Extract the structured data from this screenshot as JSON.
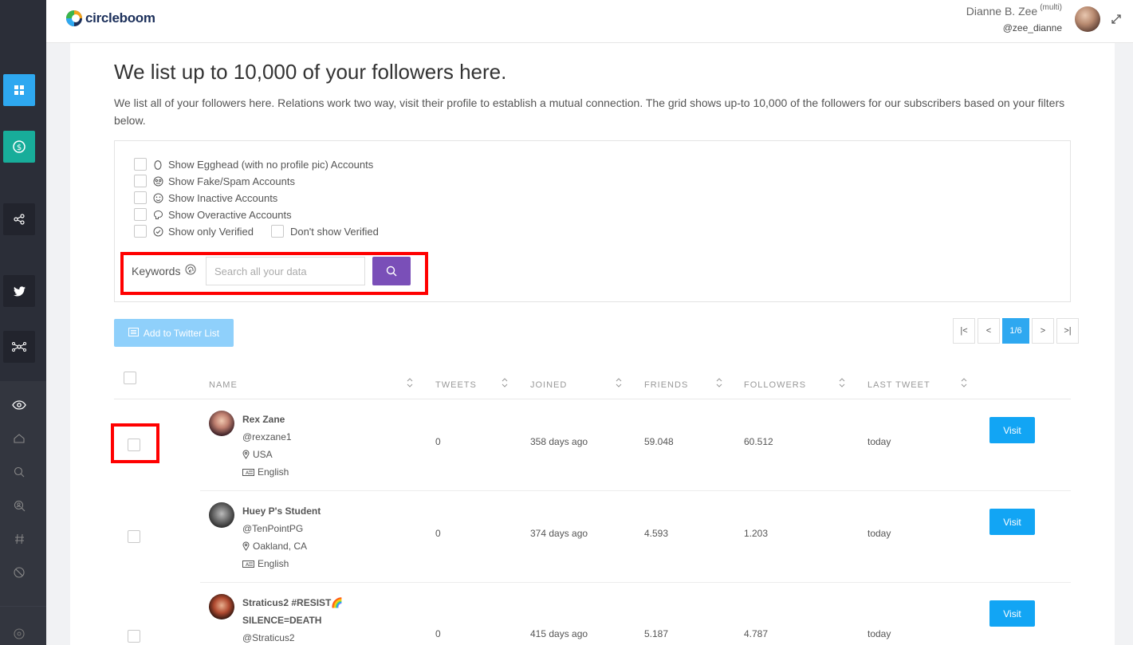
{
  "header": {
    "logo_text": "circleboom",
    "user_name": "Dianne B. Zee",
    "user_tag": "(multi)",
    "user_handle": "@zee_dianne"
  },
  "page": {
    "title": "We list up to 10,000 of your followers here.",
    "description": "We list all of your followers here. Relations work two way, visit their profile to establish a mutual connection. The grid shows up-to 10,000 of the followers for our subscribers based on your filters below."
  },
  "filters": {
    "egghead": "Show Egghead (with no profile pic) Accounts",
    "fake_spam": "Show Fake/Spam Accounts",
    "inactive": "Show Inactive Accounts",
    "overactive": "Show Overactive Accounts",
    "only_verified": "Show only Verified",
    "dont_show_verified": "Don't show Verified"
  },
  "keywords": {
    "label": "Keywords",
    "placeholder": "Search all your data"
  },
  "toolbar": {
    "add_list_label": "Add to Twitter List"
  },
  "pager": {
    "first": "|<",
    "prev": "<",
    "current": "1/6",
    "next": ">",
    "last": ">|"
  },
  "table": {
    "columns": {
      "name": "NAME",
      "tweets": "TWEETS",
      "joined": "JOINED",
      "friends": "FRIENDS",
      "followers": "FOLLOWERS",
      "last_tweet": "LAST TWEET"
    },
    "visit_label": "Visit",
    "rows": [
      {
        "name": "Rex Zane",
        "handle": "@rexzane1",
        "location": "USA",
        "language": "English",
        "tweets": "0",
        "joined": "358 days ago",
        "friends": "59.048",
        "followers": "60.512",
        "last_tweet": "today"
      },
      {
        "name": "Huey P's Student",
        "handle": "@TenPointPG",
        "location": "Oakland, CA",
        "language": "English",
        "tweets": "0",
        "joined": "374 days ago",
        "friends": "4.593",
        "followers": "1.203",
        "last_tweet": "today"
      },
      {
        "name": "Straticus2 #RESIST🌈",
        "name_line2": "SILENCE=DEATH",
        "handle": "@Straticus2",
        "tweets": "0",
        "joined": "415 days ago",
        "friends": "5.187",
        "followers": "4.787",
        "last_tweet": "today"
      }
    ]
  },
  "colors": {
    "sidebar_bg": "#2b2e38",
    "accent_blue": "#2ea8f0",
    "accent_teal": "#18ad9a",
    "search_button": "#7a4fb8",
    "highlight_red": "#ff0000",
    "visit_button": "#12a5f4"
  }
}
